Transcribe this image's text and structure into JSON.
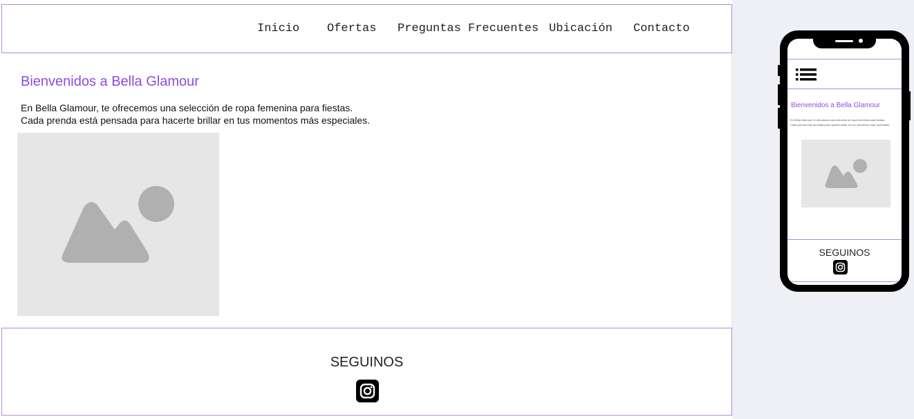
{
  "nav": {
    "items": [
      {
        "label": "Inicio"
      },
      {
        "label": "Ofertas"
      },
      {
        "label": "Preguntas Frecuentes"
      },
      {
        "label": "Ubicación"
      },
      {
        "label": "Contacto"
      }
    ]
  },
  "main": {
    "title": "Bienvenidos a Bella Glamour",
    "intro_lines": [
      "En Bella Glamour, te ofrecemos una selección de ropa femenina para fiestas.",
      "Cada prenda está pensada para hacerte brillar en tus momentos más especiales."
    ],
    "image_icon": "image-placeholder-icon"
  },
  "footer": {
    "title": "SEGUINOS",
    "social_icon": "instagram-icon"
  },
  "mobile_preview": {
    "menu_icon": "list-menu-icon",
    "title": "Bienvenidos a Bella Glamour",
    "intro_lines": [
      "En Bella Glamour, te ofrecemos una selección de ropa femenina para fiestas.",
      "Cada prenda está pensada para hacerte brillar en tus momentos más especiales."
    ],
    "footer_title": "SEGUINOS"
  },
  "colors": {
    "accent": "#8a4de0",
    "border": "#b68ad6",
    "placeholder_bg": "#e6e6e6",
    "placeholder_fg": "#b0b0b0",
    "page_bg": "#eef0f5"
  }
}
